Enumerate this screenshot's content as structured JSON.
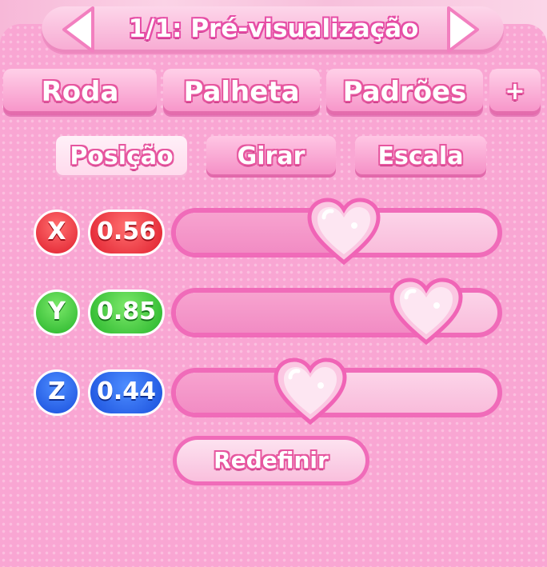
{
  "header": {
    "title": "1/1: Pré-visualização"
  },
  "tabs": {
    "items": [
      {
        "label": "Roda"
      },
      {
        "label": "Palheta"
      },
      {
        "label": "Padrões"
      },
      {
        "label": "+"
      }
    ]
  },
  "subtabs": {
    "selected": "Posição",
    "items": [
      {
        "label": "Posição"
      },
      {
        "label": "Girar"
      },
      {
        "label": "Escala"
      }
    ]
  },
  "axes": [
    {
      "label": "X",
      "value": "0.56",
      "level": 0.56,
      "color": "#e01f2e",
      "icon": "heart-slider-thumb"
    },
    {
      "label": "Y",
      "value": "0.85",
      "level": 0.85,
      "color": "#27b52a",
      "icon": "heart-slider-thumb"
    },
    {
      "label": "Z",
      "value": "0.44",
      "level": 0.44,
      "color": "#1a4fdc",
      "icon": "heart-slider-thumb"
    }
  ],
  "reset": {
    "label": "Redefinir"
  },
  "colors": {
    "panel": "#f9a6d3",
    "accent": "#f06bb9"
  }
}
